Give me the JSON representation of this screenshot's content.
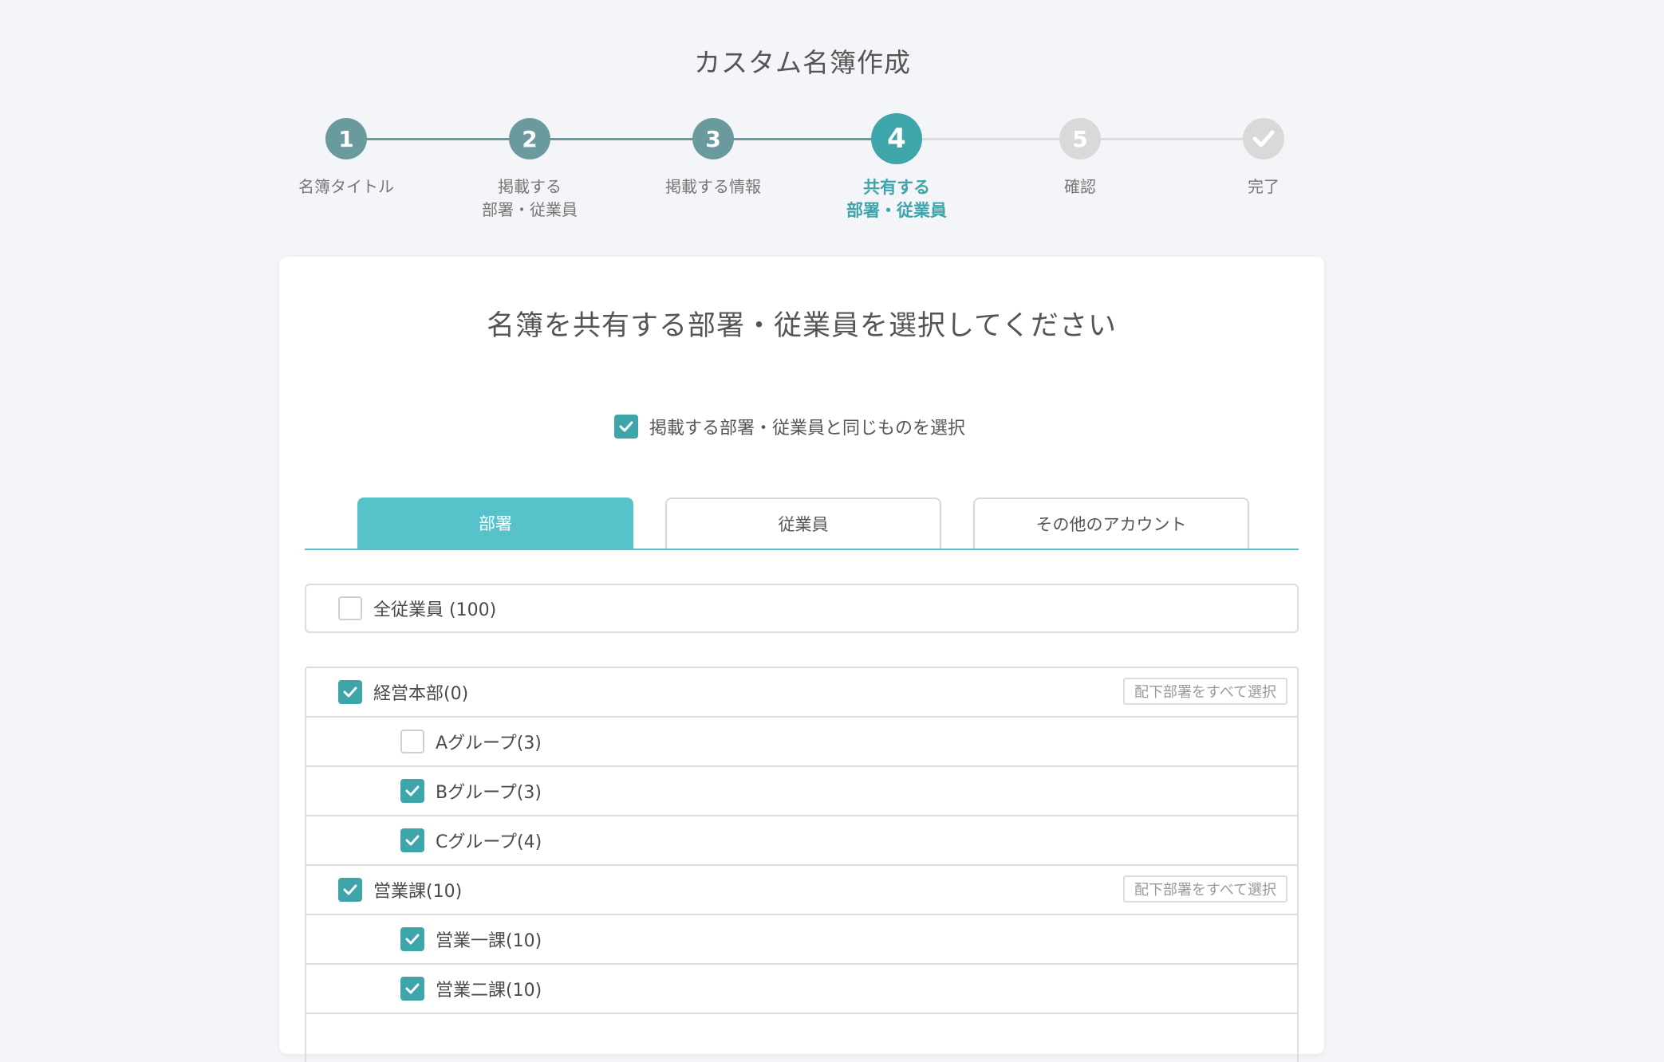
{
  "page_title": "カスタム名簿作成",
  "steps": [
    {
      "number": "1",
      "label_line1": "名簿タイトル",
      "label_line2": "",
      "state": "done"
    },
    {
      "number": "2",
      "label_line1": "掲載する",
      "label_line2": "部署・従業員",
      "state": "done"
    },
    {
      "number": "3",
      "label_line1": "掲載する情報",
      "label_line2": "",
      "state": "done"
    },
    {
      "number": "4",
      "label_line1": "共有する",
      "label_line2": "部署・従業員",
      "state": "current"
    },
    {
      "number": "5",
      "label_line1": "確認",
      "label_line2": "",
      "state": "todo"
    },
    {
      "number": "",
      "label_line1": "完了",
      "label_line2": "",
      "state": "todo",
      "icon": "check-icon"
    }
  ],
  "card": {
    "title": "名簿を共有する部署・従業員を選択してください",
    "same_as_listed": {
      "label": "掲載する部署・従業員と同じものを選択",
      "checked": true
    },
    "tabs": [
      {
        "label": "部署",
        "active": true
      },
      {
        "label": "従業員",
        "active": false
      },
      {
        "label": "その他のアカウント",
        "active": false
      }
    ],
    "all_employees": {
      "label": "全従業員 (100)",
      "checked": false
    },
    "departments": [
      {
        "label": "経営本部(0)",
        "level": 0,
        "checked": true,
        "select_all_label": "配下部署をすべて選択"
      },
      {
        "label": "Aグループ(3)",
        "level": 1,
        "checked": false
      },
      {
        "label": "Bグループ(3)",
        "level": 1,
        "checked": true
      },
      {
        "label": "Cグループ(4)",
        "level": 1,
        "checked": true
      },
      {
        "label": "営業課(10)",
        "level": 0,
        "checked": true,
        "select_all_label": "配下部署をすべて選択"
      },
      {
        "label": "営業一課(10)",
        "level": 1,
        "checked": true
      },
      {
        "label": "営業二課(10)",
        "level": 1,
        "checked": true
      }
    ]
  },
  "colors": {
    "accent": "#3ea5ab",
    "tab_active": "#58c2cb",
    "done": "#6b9a9e",
    "todo": "#d9d9d9"
  }
}
